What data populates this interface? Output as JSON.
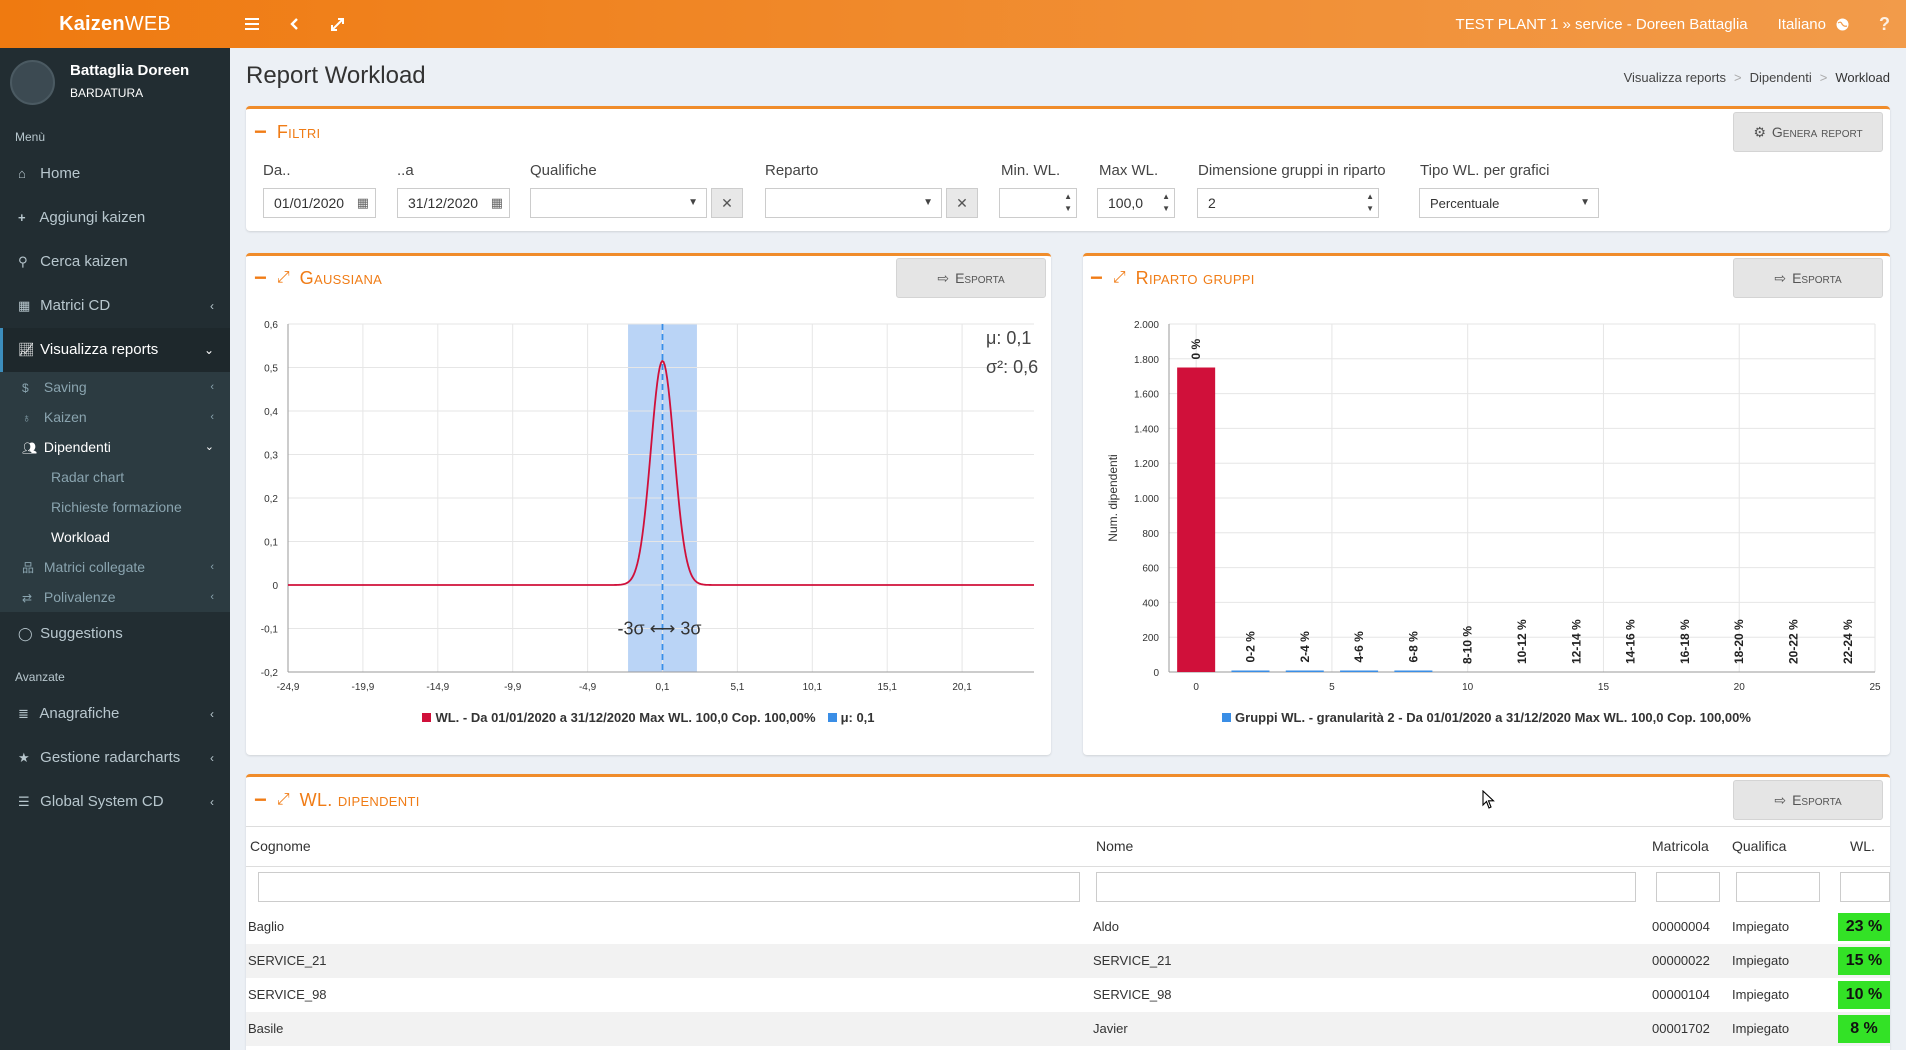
{
  "app": {
    "logo_bold": "Kaizen",
    "logo_rest": "WEB"
  },
  "topbar": {
    "context": "TEST PLANT 1 » service - Doreen Battaglia",
    "language": "Italiano"
  },
  "user": {
    "name": "Battaglia Doreen",
    "role": "BARDATURA"
  },
  "sidebar": {
    "section_menu": "Menù",
    "home": "Home",
    "add": "Aggiungi kaizen",
    "search": "Cerca kaizen",
    "matrici": "Matrici CD",
    "reports": "Visualizza reports",
    "saving": "Saving",
    "kaizen": "Kaizen",
    "dipendenti": "Dipendenti",
    "radar": "Radar chart",
    "formazione": "Richieste formazione",
    "workload": "Workload",
    "matrici_collegate": "Matrici collegate",
    "polivalenze": "Polivalenze",
    "suggestions": "Suggestions",
    "section_advanced": "Avanzate",
    "anagrafiche": "Anagrafiche",
    "radarcharts": "Gestione radarcharts",
    "global": "Global System CD"
  },
  "page": {
    "title": "Report Workload"
  },
  "breadcrumb": [
    "Visualizza reports",
    "Dipendenti",
    "Workload"
  ],
  "filters": {
    "title": "Filtri",
    "generate": "Genera report",
    "da_label": "Da..",
    "da_value": "01/01/2020",
    "a_label": "..a",
    "a_value": "31/12/2020",
    "qualifiche_label": "Qualifiche",
    "qualifiche_value": "",
    "reparto_label": "Reparto",
    "reparto_value": "",
    "minwl_label": "Min. WL.",
    "minwl_value": "",
    "maxwl_label": "Max WL.",
    "maxwl_value": "100,0",
    "gruppi_label": "Dimensione gruppi in riparto",
    "gruppi_value": "2",
    "tipo_label": "Tipo WL. per grafici",
    "tipo_value": "Percentuale"
  },
  "export_label": "Esporta",
  "gauss": {
    "title": "Gaussiana",
    "mu_label": "μ: 0,1",
    "sigma_label": "σ²: 0,6",
    "range_label": "-3σ ⟷ 3σ",
    "legend_curve": "WL. - Da 01/01/2020 a 31/12/2020 Max WL. 100,0  Cop. 100,00%",
    "legend_mu": "μ: 0,1",
    "colors": {
      "curve": "#d0103a",
      "band": "#aecdf5",
      "mu": "#3a8ee6"
    }
  },
  "riparto": {
    "title": "Riparto gruppi",
    "legend": "Gruppi WL. - granularità 2 - Da 01/01/2020 a 31/12/2020 Max WL. 100,0  Cop. 100,00%",
    "colors": {
      "first": "#d0103a",
      "rest": "#3a8ee6"
    }
  },
  "chart_data": [
    {
      "type": "line",
      "title": "Gaussiana",
      "x_ticks": [
        "-24,9",
        "-19,9",
        "-14,9",
        "-9,9",
        "-4,9",
        "0,1",
        "5,1",
        "10,1",
        "15,1",
        "20,1"
      ],
      "x_tick_values": [
        -24.9,
        -19.9,
        -14.9,
        -9.9,
        -4.9,
        0.1,
        5.1,
        10.1,
        15.1,
        20.1
      ],
      "y_ticks": [
        "0,6",
        "0,5",
        "0,4",
        "0,3",
        "0,2",
        "0,1",
        "0",
        "-0,1",
        "-0,2"
      ],
      "y_tick_values": [
        0.6,
        0.5,
        0.4,
        0.3,
        0.2,
        0.1,
        0,
        -0.1,
        -0.2
      ],
      "xlim": [
        -24.9,
        24.9
      ],
      "ylim": [
        -0.2,
        0.6
      ],
      "series": [
        {
          "name": "WL. - Da 01/01/2020 a 31/12/2020 Max WL. 100,0  Cop. 100,00%",
          "mean": 0.1,
          "variance": 0.6
        }
      ],
      "band": [
        -2.2,
        2.4
      ],
      "mu": 0.1,
      "grid": true
    },
    {
      "type": "bar",
      "title": "Riparto gruppi",
      "ylabel": "Num. dipendenti",
      "x_ticks": [
        "0",
        "5",
        "10",
        "15",
        "20",
        "25"
      ],
      "x_tick_values": [
        0,
        5,
        10,
        15,
        20,
        25
      ],
      "y_ticks": [
        "2.000",
        "1.800",
        "1.600",
        "1.400",
        "1.200",
        "1.000",
        "800",
        "600",
        "400",
        "200",
        "0"
      ],
      "y_tick_values": [
        2000,
        1800,
        1600,
        1400,
        1200,
        1000,
        800,
        600,
        400,
        200,
        0
      ],
      "xlim": [
        -1,
        25
      ],
      "ylim": [
        0,
        2000
      ],
      "categories": [
        "0",
        "0-2",
        "2-4",
        "4-6",
        "6-8",
        "8-10",
        "10-12",
        "12-14",
        "14-16",
        "16-18",
        "18-20",
        "20-22",
        "22-24"
      ],
      "x_positions": [
        0,
        2,
        4,
        6,
        8,
        10,
        12,
        14,
        16,
        18,
        20,
        22,
        24
      ],
      "values": [
        1750,
        2,
        5,
        3,
        1,
        0,
        0,
        0,
        0,
        0,
        0,
        0,
        0
      ],
      "data_labels": [
        "0 %",
        "0-2 %",
        "2-4 %",
        "4-6 %",
        "6-8 %",
        "8-10 %",
        "10-12 %",
        "12-14 %",
        "14-16 %",
        "16-18 %",
        "18-20 %",
        "20-22 %",
        "22-24 %"
      ],
      "grid": true
    }
  ],
  "table": {
    "title": "WL. dipendenti",
    "headers": {
      "cognome": "Cognome",
      "nome": "Nome",
      "matricola": "Matricola",
      "qualifica": "Qualifica",
      "wl": "WL."
    },
    "rows": [
      {
        "cognome": "Baglio",
        "nome": "Aldo",
        "matricola": "00000004",
        "qualifica": "Impiegato",
        "wl": "23 %"
      },
      {
        "cognome": "SERVICE_21",
        "nome": "SERVICE_21",
        "matricola": "00000022",
        "qualifica": "Impiegato",
        "wl": "15 %"
      },
      {
        "cognome": "SERVICE_98",
        "nome": "SERVICE_98",
        "matricola": "00000104",
        "qualifica": "Impiegato",
        "wl": "10 %"
      },
      {
        "cognome": "Basile",
        "nome": "Javier",
        "matricola": "00001702",
        "qualifica": "Impiegato",
        "wl": "8 %"
      }
    ]
  }
}
